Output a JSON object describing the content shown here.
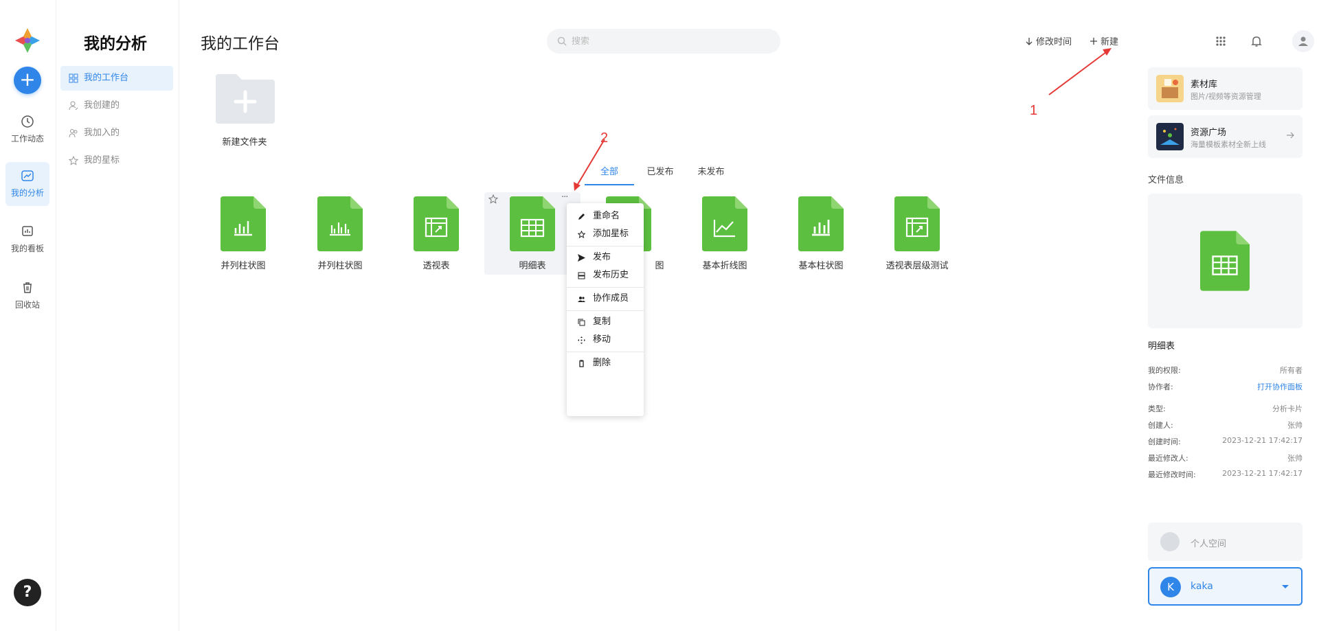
{
  "rail": {
    "items": [
      {
        "label": "工作动态"
      },
      {
        "label": "我的分析"
      },
      {
        "label": "我的看板"
      },
      {
        "label": "回收站"
      }
    ],
    "help": "?"
  },
  "sidebar": {
    "title": "我的分析",
    "items": [
      {
        "label": "我的工作台"
      },
      {
        "label": "我创建的"
      },
      {
        "label": "我加入的"
      },
      {
        "label": "我的星标"
      }
    ]
  },
  "header": {
    "title": "我的工作台",
    "search_placeholder": "搜索",
    "sort_label": "修改时间",
    "new_label": "新建"
  },
  "folder": {
    "label": "新建文件夹"
  },
  "tabs": [
    {
      "label": "全部"
    },
    {
      "label": "已发布"
    },
    {
      "label": "未发布"
    }
  ],
  "files": [
    {
      "name": "并列柱状图",
      "icon": "bar-chart-icon"
    },
    {
      "name": "并列柱状图",
      "icon": "grouped-bar-icon"
    },
    {
      "name": "透视表",
      "icon": "pivot-table-icon"
    },
    {
      "name": "明细表",
      "icon": "table-icon"
    },
    {
      "name": "图",
      "icon": "chart-icon"
    },
    {
      "name": "基本折线图",
      "icon": "line-chart-icon"
    },
    {
      "name": "基本柱状图",
      "icon": "bar-chart-icon"
    },
    {
      "name": "透视表层级测试",
      "icon": "pivot-table-icon"
    }
  ],
  "file_more": "···",
  "context_menu": [
    {
      "label": "重命名"
    },
    {
      "label": "添加星标"
    },
    {
      "label": "发布"
    },
    {
      "label": "发布历史"
    },
    {
      "label": "协作成员"
    },
    {
      "label": "复制"
    },
    {
      "label": "移动"
    },
    {
      "label": "删除"
    }
  ],
  "annotations": {
    "one": "1",
    "two": "2"
  },
  "right_panel": {
    "cards": [
      {
        "title": "素材库",
        "subtitle": "图片/视频等资源管理"
      },
      {
        "title": "资源广场",
        "subtitle": "海量模板素材全新上线"
      }
    ],
    "section_title": "文件信息",
    "file_name": "明细表",
    "details": [
      {
        "key": "我的权限:",
        "value": "所有者"
      },
      {
        "key": "协作者:",
        "value": "打开协作面板"
      },
      {
        "key": "类型:",
        "value": "分析卡片"
      },
      {
        "key": "创建人:",
        "value": "张帅"
      },
      {
        "key": "创建时间:",
        "value": "2023-12-21 17:42:17"
      },
      {
        "key": "最近修改人:",
        "value": "张帅"
      },
      {
        "key": "最近修改时间:",
        "value": "2023-12-21 17:42:17"
      }
    ],
    "space_label": "个人空间",
    "user": {
      "initial": "K",
      "name": "kaka"
    }
  },
  "colors": {
    "accent": "#2f86e8",
    "file_green": "#5cbf3f",
    "annotation_red": "#e53935"
  }
}
